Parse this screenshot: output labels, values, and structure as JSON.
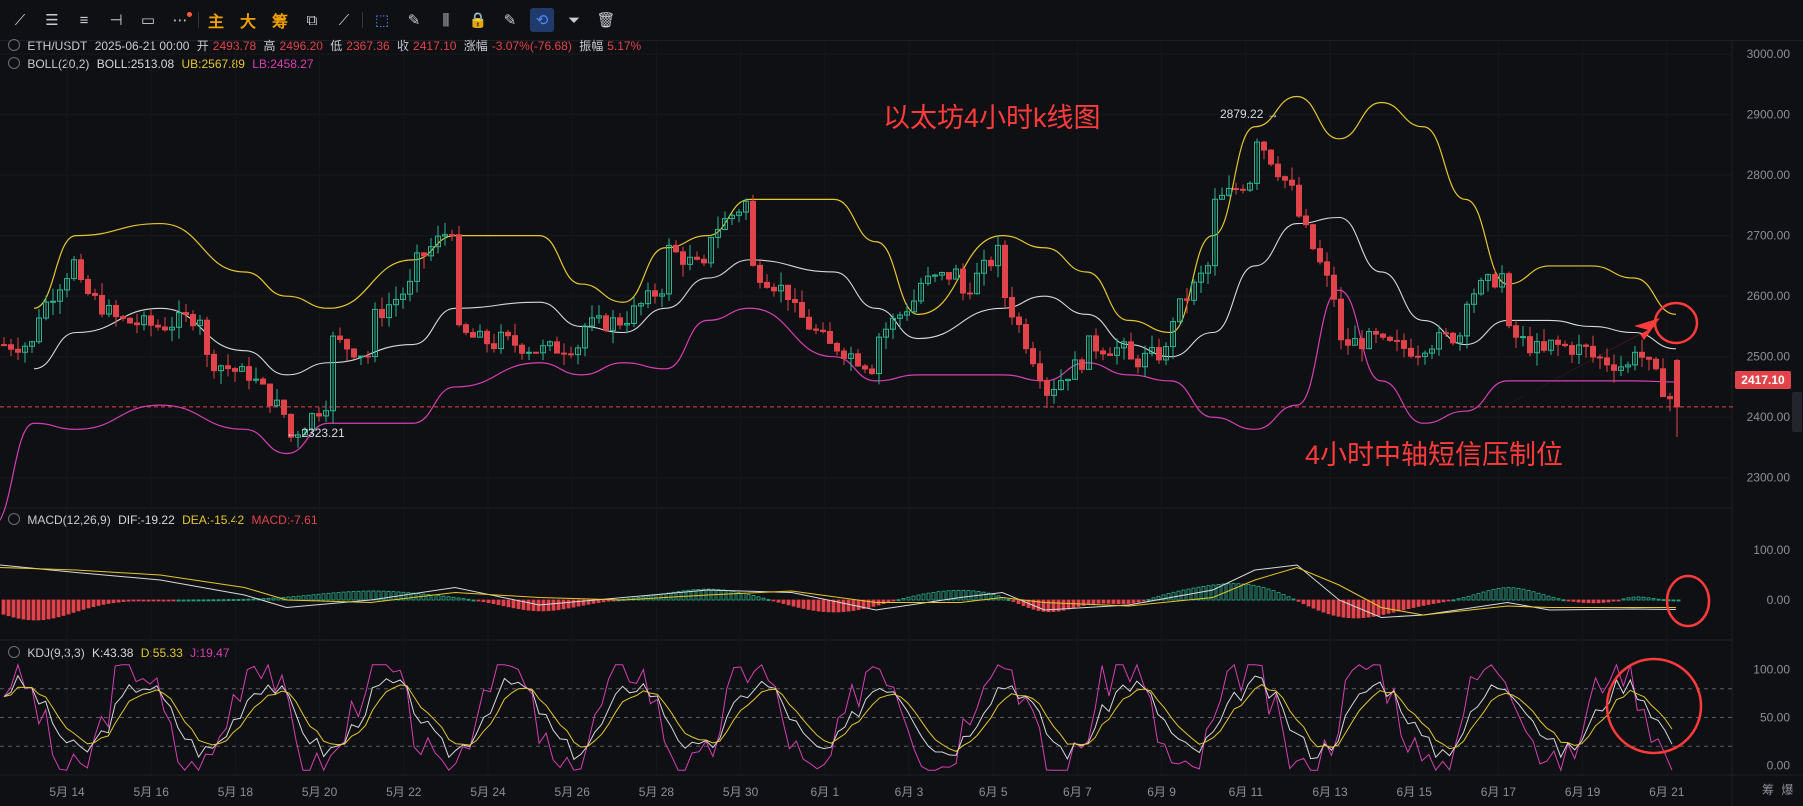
{
  "toolbar": {
    "tools": [
      {
        "name": "line-tool-icon",
        "glyph": "⟋"
      },
      {
        "name": "parallel-line-icon",
        "glyph": "☰"
      },
      {
        "name": "horizontal-lines-icon",
        "glyph": "≡"
      },
      {
        "name": "horizontal-ray-icon",
        "glyph": "⊣"
      },
      {
        "name": "rectangle-icon",
        "glyph": "▭"
      },
      {
        "name": "more-icon",
        "glyph": "⋯"
      }
    ],
    "text_buttons": [
      "主",
      "大",
      "筹"
    ],
    "extra_tools": [
      {
        "name": "copy-icon",
        "glyph": "⧉"
      },
      {
        "name": "measure-icon",
        "glyph": "⟋"
      },
      {
        "name": "select-icon",
        "glyph": "⬚"
      },
      {
        "name": "eraser-icon",
        "glyph": "✎"
      },
      {
        "name": "candle-type-icon",
        "glyph": "⫼"
      },
      {
        "name": "lock-icon",
        "glyph": "🔒"
      },
      {
        "name": "note-icon",
        "glyph": "✎"
      },
      {
        "name": "magnet-icon",
        "glyph": "⟲"
      },
      {
        "name": "filter-icon",
        "glyph": "⏷"
      },
      {
        "name": "delete-icon",
        "glyph": "🗑"
      }
    ]
  },
  "header": {
    "symbol": "ETH/USDT",
    "datetime": "2025-06-21 00:00",
    "open_label": "开",
    "open": "2493.78",
    "high_label": "高",
    "high": "2496.20",
    "low_label": "低",
    "low": "2367.36",
    "close_label": "收",
    "close": "2417.10",
    "change_label": "涨幅",
    "change": "-3.07%(-76.68)",
    "amplitude_label": "振幅",
    "amplitude": "5.17%"
  },
  "boll_legend": {
    "name": "BOLL(20,2)",
    "mid": "BOLL:2513.08",
    "ub": "UB:2567.89",
    "lb": "LB:2458.27"
  },
  "macd_legend": {
    "name": "MACD(12,26,9)",
    "dif": "DIF:-19.22",
    "dea": "DEA:-15.42",
    "macd": "MACD:-7.61"
  },
  "kdj_legend": {
    "name": "KDJ(9,3,3)",
    "k": "K:43.38",
    "d": "D:55.33",
    "j": "J:19.47"
  },
  "price_axis": [
    "3000.00",
    "2900.00",
    "2800.00",
    "2700.00",
    "2600.00",
    "2500.00",
    "2400.00",
    "2300.00"
  ],
  "macd_axis": [
    "100.00",
    "0.00"
  ],
  "kdj_axis": [
    "100.00",
    "50.00",
    "0.00"
  ],
  "current_price": "2417.10",
  "markers": {
    "high": "2879.22",
    "low": "2323.21"
  },
  "annotations": {
    "title": "以太坊4小时k线图",
    "note": "4小时中轴短信压制位"
  },
  "bottom_right": [
    "筹",
    "爆"
  ],
  "colors": {
    "up": "#2bb58f",
    "down": "#e0444a",
    "ub": "#e6c62d",
    "mid": "#d6d8dc",
    "lb": "#d63fb3",
    "dif": "#d6d8dc",
    "dea": "#e6c62d",
    "j": "#d63fb3",
    "annot": "#ff3b3b"
  },
  "chart_data": [
    {
      "type": "candlestick",
      "title": "ETH/USDT",
      "x_labels": [
        "5月 14",
        "5月 16",
        "5月 18",
        "5月 20",
        "5月 22",
        "5月 24",
        "5月 26",
        "5月 28",
        "5月 30",
        "6月 1",
        "6月 3",
        "6月 5",
        "6月 7",
        "6月 9",
        "6月 11",
        "6月 13",
        "6月 15",
        "6月 17",
        "6月 19",
        "6月 21"
      ],
      "ylim": [
        2250,
        3020
      ],
      "close_path": [
        [
          "5/13",
          2520
        ],
        [
          "5/13",
          2560
        ],
        [
          "5/14",
          2660
        ],
        [
          "5/14",
          2620
        ],
        [
          "5/15",
          2560
        ],
        [
          "5/16",
          2550
        ],
        [
          "5/17",
          2570
        ],
        [
          "5/17",
          2500
        ],
        [
          "5/18",
          2470
        ],
        [
          "5/18",
          2480
        ],
        [
          "5/19",
          2400
        ],
        [
          "5/19",
          2360
        ],
        [
          "5/20",
          2430
        ],
        [
          "5/20",
          2530
        ],
        [
          "5/21",
          2500
        ],
        [
          "5/21",
          2560
        ],
        [
          "5/22",
          2620
        ],
        [
          "5/22",
          2650
        ],
        [
          "5/23",
          2720
        ],
        [
          "5/23",
          2540
        ],
        [
          "5/24",
          2520
        ],
        [
          "5/24",
          2530
        ],
        [
          "5/25",
          2510
        ],
        [
          "5/26",
          2520
        ],
        [
          "5/26",
          2550
        ],
        [
          "5/27",
          2560
        ],
        [
          "5/28",
          2620
        ],
        [
          "5/28",
          2680
        ],
        [
          "5/29",
          2640
        ],
        [
          "5/29",
          2700
        ],
        [
          "5/30",
          2760
        ],
        [
          "5/30",
          2650
        ],
        [
          "5/31",
          2600
        ],
        [
          "5/31",
          2580
        ],
        [
          "6/1",
          2510
        ],
        [
          "6/1",
          2520
        ],
        [
          "6/2",
          2480
        ],
        [
          "6/2",
          2530
        ],
        [
          "6/3",
          2600
        ],
        [
          "6/3",
          2620
        ],
        [
          "6/4",
          2640
        ],
        [
          "6/4",
          2600
        ],
        [
          "6/5",
          2680
        ],
        [
          "6/5",
          2610
        ],
        [
          "6/6",
          2460
        ],
        [
          "6/6",
          2440
        ],
        [
          "6/7",
          2500
        ],
        [
          "6/7",
          2520
        ],
        [
          "6/8",
          2510
        ],
        [
          "6/8",
          2490
        ],
        [
          "6/9",
          2510
        ],
        [
          "6/9",
          2560
        ],
        [
          "6/10",
          2660
        ],
        [
          "6/10",
          2750
        ],
        [
          "6/11",
          2800
        ],
        [
          "6/11",
          2870
        ],
        [
          "6/12",
          2760
        ],
        [
          "6/12",
          2740
        ],
        [
          "6/13",
          2580
        ],
        [
          "6/13",
          2520
        ],
        [
          "6/14",
          2530
        ],
        [
          "6/14",
          2520
        ],
        [
          "6/15",
          2510
        ],
        [
          "6/15",
          2520
        ],
        [
          "6/16",
          2540
        ],
        [
          "6/16",
          2600
        ],
        [
          "6/17",
          2640
        ],
        [
          "6/17",
          2540
        ],
        [
          "6/18",
          2500
        ],
        [
          "6/18",
          2520
        ],
        [
          "6/19",
          2510
        ],
        [
          "6/19",
          2500
        ],
        [
          "6/20",
          2480
        ],
        [
          "6/20",
          2520
        ],
        [
          "6/21",
          2417.1
        ]
      ],
      "boll_ub_path": [
        [
          "5/13",
          2580
        ],
        [
          "5/14",
          2700
        ],
        [
          "5/16",
          2720
        ],
        [
          "5/18",
          2640
        ],
        [
          "5/19",
          2600
        ],
        [
          "5/20",
          2580
        ],
        [
          "5/22",
          2660
        ],
        [
          "5/23",
          2700
        ],
        [
          "5/25",
          2700
        ],
        [
          "5/26",
          2620
        ],
        [
          "5/27",
          2590
        ],
        [
          "5/28",
          2680
        ],
        [
          "5/29",
          2700
        ],
        [
          "5/30",
          2760
        ],
        [
          "6/1",
          2760
        ],
        [
          "6/2",
          2690
        ],
        [
          "6/3",
          2570
        ],
        [
          "6/5",
          2700
        ],
        [
          "6/6",
          2680
        ],
        [
          "6/7",
          2640
        ],
        [
          "6/8",
          2560
        ],
        [
          "6/9",
          2540
        ],
        [
          "6/10",
          2700
        ],
        [
          "6/11",
          2880
        ],
        [
          "6/12",
          2930
        ],
        [
          "6/13",
          2860
        ],
        [
          "6/14",
          2920
        ],
        [
          "6/15",
          2880
        ],
        [
          "6/16",
          2760
        ],
        [
          "6/17",
          2620
        ],
        [
          "6/18",
          2650
        ],
        [
          "6/19",
          2650
        ],
        [
          "6/20",
          2630
        ],
        [
          "6/21",
          2570
        ]
      ],
      "boll_mid_path": [
        [
          "5/13",
          2480
        ],
        [
          "5/14",
          2540
        ],
        [
          "5/16",
          2580
        ],
        [
          "5/18",
          2510
        ],
        [
          "5/19",
          2470
        ],
        [
          "5/20",
          2490
        ],
        [
          "5/22",
          2520
        ],
        [
          "5/23",
          2580
        ],
        [
          "5/25",
          2590
        ],
        [
          "5/26",
          2550
        ],
        [
          "5/27",
          2540
        ],
        [
          "5/28",
          2580
        ],
        [
          "5/29",
          2630
        ],
        [
          "5/30",
          2660
        ],
        [
          "6/1",
          2640
        ],
        [
          "6/2",
          2580
        ],
        [
          "6/3",
          2530
        ],
        [
          "6/5",
          2580
        ],
        [
          "6/6",
          2600
        ],
        [
          "6/7",
          2570
        ],
        [
          "6/8",
          2520
        ],
        [
          "6/9",
          2500
        ],
        [
          "6/10",
          2540
        ],
        [
          "6/11",
          2650
        ],
        [
          "6/12",
          2720
        ],
        [
          "6/13",
          2730
        ],
        [
          "6/14",
          2640
        ],
        [
          "6/15",
          2560
        ],
        [
          "6/16",
          2520
        ],
        [
          "6/17",
          2560
        ],
        [
          "6/18",
          2560
        ],
        [
          "6/19",
          2550
        ],
        [
          "6/20",
          2540
        ],
        [
          "6/21",
          2513.08
        ]
      ],
      "boll_lb_path": [
        [
          "5/12",
          2220
        ],
        [
          "5/13",
          2390
        ],
        [
          "5/14",
          2380
        ],
        [
          "5/16",
          2420
        ],
        [
          "5/18",
          2380
        ],
        [
          "5/19",
          2340
        ],
        [
          "5/20",
          2390
        ],
        [
          "5/22",
          2390
        ],
        [
          "5/23",
          2450
        ],
        [
          "5/25",
          2490
        ],
        [
          "5/26",
          2470
        ],
        [
          "5/27",
          2490
        ],
        [
          "5/28",
          2480
        ],
        [
          "5/29",
          2560
        ],
        [
          "5/30",
          2580
        ],
        [
          "6/1",
          2500
        ],
        [
          "6/2",
          2460
        ],
        [
          "6/3",
          2470
        ],
        [
          "6/5",
          2470
        ],
        [
          "6/6",
          2460
        ],
        [
          "6/7",
          2490
        ],
        [
          "6/8",
          2470
        ],
        [
          "6/9",
          2460
        ],
        [
          "6/10",
          2400
        ],
        [
          "6/11",
          2380
        ],
        [
          "6/12",
          2420
        ],
        [
          "6/13",
          2610
        ],
        [
          "6/14",
          2460
        ],
        [
          "6/15",
          2390
        ],
        [
          "6/16",
          2410
        ],
        [
          "6/17",
          2460
        ],
        [
          "6/18",
          2460
        ],
        [
          "6/19",
          2460
        ],
        [
          "6/20",
          2460
        ],
        [
          "6/21",
          2458.27
        ]
      ]
    },
    {
      "type": "macd",
      "ylim": [
        -80,
        140
      ],
      "dif": -19.22,
      "dea": -15.42,
      "macd": -7.61
    },
    {
      "type": "kdj",
      "ylim": [
        -10,
        110
      ],
      "k": 43.38,
      "d": 55.33,
      "j": 19.47
    }
  ]
}
